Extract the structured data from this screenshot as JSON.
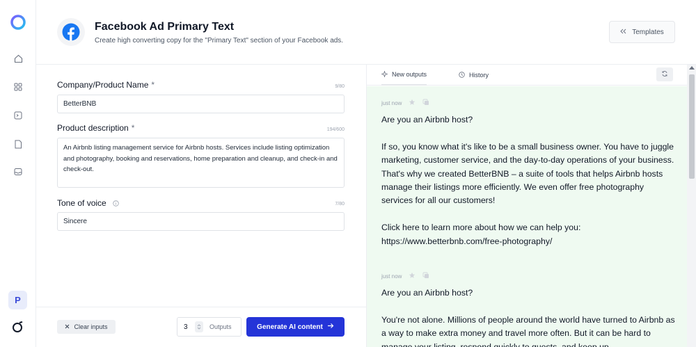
{
  "rail": {
    "icons": [
      "home-icon",
      "grid-icon",
      "terminal-icon",
      "document-icon",
      "inbox-icon"
    ],
    "avatar_letter": "P"
  },
  "header": {
    "title": "Facebook Ad Primary Text",
    "subtitle": "Create high converting copy for the \"Primary Text\" section of your Facebook ads.",
    "templates_label": "Templates"
  },
  "form": {
    "company": {
      "label": "Company/Product Name",
      "required": "*",
      "counter": "9/80",
      "value": "BetterBNB"
    },
    "description": {
      "label": "Product description",
      "required": "*",
      "counter": "194/600",
      "value": "An Airbnb listing management service for Airbnb hosts. Services include listing optimization and photography, booking and reservations, home preparation and cleanup, and check-in and check-out."
    },
    "tone": {
      "label": "Tone of voice",
      "counter": "7/80",
      "value": "Sincere"
    },
    "clear_label": "Clear inputs",
    "outputs_value": "3",
    "outputs_label": "Outputs",
    "generate_label": "Generate AI content"
  },
  "output": {
    "tabs": [
      {
        "label": "New outputs",
        "icon": "sparkle-icon",
        "active": true
      },
      {
        "label": "History",
        "icon": "clock-icon",
        "active": false
      }
    ],
    "results": [
      {
        "time": "just now",
        "text": "Are you an Airbnb host?\n\nIf so, you know what it's like to be a small business owner. You have to juggle marketing, customer service, and the day-to-day operations of your business. That's why we created BetterBNB – a suite of tools that helps Airbnb hosts manage their listings more efficiently. We even offer free photography services for all our customers!\n\nClick here to learn more about how we can help you: https://www.betterbnb.com/free-photography/"
      },
      {
        "time": "just now",
        "text": "Are you an Airbnb host?\n\nYou're not alone. Millions of people around the world have turned to Airbnb as a way to make extra money and travel more often. But it can be hard to manage your listing, respond quickly to guests, and keep up"
      }
    ]
  },
  "colors": {
    "accent": "#2434d8",
    "result_bg": "#effaf1",
    "facebook": "#1877f2"
  }
}
